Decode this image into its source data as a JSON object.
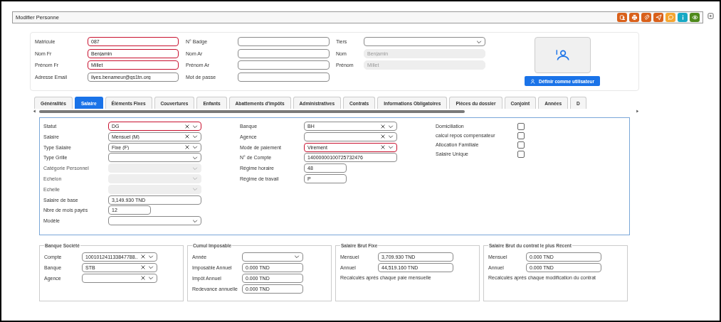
{
  "window": {
    "title": "Modifier Personne"
  },
  "toolbar": [
    {
      "kind": "contacts",
      "color": "#d9601a"
    },
    {
      "kind": "print",
      "color": "#d9601a"
    },
    {
      "kind": "attach",
      "color": "#d9601a"
    },
    {
      "kind": "send",
      "color": "#d9601a"
    },
    {
      "kind": "chat",
      "color": "#f5a530"
    },
    {
      "kind": "info",
      "color": "#17a8c4"
    },
    {
      "kind": "view",
      "color": "#4f8a1c"
    }
  ],
  "identity": {
    "columns": [
      {
        "fields": [
          {
            "label": "Matricule",
            "value": "087",
            "kind": "text",
            "required": true
          },
          {
            "label": "Nom Fr",
            "value": "Benjamin",
            "kind": "text",
            "required": true
          },
          {
            "label": "Prénom Fr",
            "value": "Millet",
            "kind": "text",
            "required": true
          },
          {
            "label": "Adresse Email",
            "value": "ilyes.benameur@gs1tn.org",
            "kind": "text",
            "required": false
          }
        ]
      },
      {
        "fields": [
          {
            "label": "N° Badge",
            "kind": "text",
            "required": false
          },
          {
            "label": "Nom Ar",
            "kind": "text",
            "required": false
          },
          {
            "label": "Prénom Ar",
            "kind": "text",
            "required": false
          },
          {
            "label": "Mot de passe",
            "kind": "text",
            "required": false
          }
        ]
      },
      {
        "fields": [
          {
            "label": "Tiers",
            "kind": "select"
          },
          {
            "label": "Nom",
            "value": "Benjamin",
            "kind": "readonly"
          },
          {
            "label": "Prénom",
            "value": "Millet",
            "kind": "readonly"
          }
        ]
      }
    ],
    "user_button": "Définir comme utilisateur"
  },
  "tabs": [
    {
      "label": "Généralités",
      "selected": false
    },
    {
      "label": "Salaire",
      "selected": true
    },
    {
      "label": "Éléments Fixes",
      "selected": false
    },
    {
      "label": "Couvertures",
      "selected": false
    },
    {
      "label": "Enfants",
      "selected": false
    },
    {
      "label": "Abattements d'impôts",
      "selected": false
    },
    {
      "label": "Administratives",
      "selected": false
    },
    {
      "label": "Contrats",
      "selected": false
    },
    {
      "label": "Informations Obligatoires",
      "selected": false
    },
    {
      "label": "Pièces du dossier",
      "selected": false
    },
    {
      "label": "Conjoint",
      "selected": false
    },
    {
      "label": "Années",
      "selected": false
    },
    {
      "label": "D",
      "selected": false
    }
  ],
  "salary": {
    "left": [
      {
        "label": "Statut",
        "value": "DG",
        "kind": "select",
        "required": true,
        "clearable": true,
        "disabled": false
      },
      {
        "label": "Salaire",
        "value": "Mensuel (M)",
        "kind": "select",
        "required": false,
        "clearable": true,
        "disabled": false
      },
      {
        "label": "Type Salaire",
        "value": "Fixe (F)",
        "kind": "select",
        "required": false,
        "clearable": true,
        "disabled": false
      },
      {
        "label": "Type Grille",
        "kind": "select",
        "required": false,
        "clearable": false,
        "disabled": false
      },
      {
        "label": "Catégorie Personnel",
        "kind": "select",
        "required": false,
        "clearable": false,
        "disabled": true
      },
      {
        "label": "Echelon",
        "kind": "select",
        "required": false,
        "clearable": false,
        "disabled": true
      },
      {
        "label": "Echelle",
        "kind": "select",
        "required": false,
        "clearable": false,
        "disabled": true
      },
      {
        "label": "Salaire de base",
        "value": "3,149.930 TND",
        "kind": "text",
        "required": false,
        "clearable": false,
        "disabled": false
      },
      {
        "label": "Nbre de mois payés",
        "value": "12",
        "kind": "number",
        "required": false,
        "clearable": false,
        "disabled": false
      },
      {
        "label": "Modèle",
        "kind": "select",
        "required": false,
        "clearable": false,
        "disabled": false
      }
    ],
    "middle": [
      {
        "label": "Banque",
        "value": "BH",
        "kind": "select",
        "required": false,
        "clearable": true,
        "disabled": false
      },
      {
        "label": "Agence",
        "kind": "select",
        "required": false,
        "clearable": true,
        "disabled": false
      },
      {
        "label": "Mode de paiement",
        "value": "Virement",
        "kind": "select",
        "required": true,
        "clearable": true,
        "disabled": false
      },
      {
        "label": "N° de Compte",
        "value": "14000000100725732476",
        "kind": "text",
        "required": false,
        "clearable": false,
        "disabled": false
      },
      {
        "label": "Régime horaire",
        "value": "48",
        "kind": "number",
        "required": false,
        "clearable": false,
        "disabled": false
      },
      {
        "label": "Régime de travail",
        "value": "P",
        "kind": "number",
        "required": false,
        "clearable": false,
        "disabled": false
      }
    ],
    "options": [
      {
        "label": "Domiciliation",
        "checked": false
      },
      {
        "label": "calcul repos compensateur",
        "checked": false
      },
      {
        "label": "Allocation Familiale",
        "checked": false
      },
      {
        "label": "Salaire Unique",
        "checked": false
      }
    ]
  },
  "groups": [
    {
      "title": "Banque Société",
      "fields": [
        {
          "label": "Compte",
          "value": "100101241133847788...",
          "kind": "select",
          "clearable": true
        },
        {
          "label": "Banque",
          "value": "STB",
          "kind": "select",
          "clearable": true
        },
        {
          "label": "Agence",
          "kind": "select",
          "clearable": true
        }
      ]
    },
    {
      "title": "Cumul Imposable",
      "fields": [
        {
          "label": "Année",
          "kind": "select",
          "clearable": false
        },
        {
          "label": "Imposable Annuel",
          "value": "0.000 TND",
          "kind": "text",
          "clearable": false
        },
        {
          "label": "Impôt Annuel",
          "value": "0.000 TND",
          "kind": "text",
          "clearable": false
        },
        {
          "label": "Redevance annuelle",
          "value": "0.000 TND",
          "kind": "text",
          "clearable": false
        }
      ]
    },
    {
      "title": "Salaire Brut Fixe",
      "fields": [
        {
          "label": "Mensuel",
          "value": "3,709.930 TND",
          "kind": "text",
          "clearable": false
        },
        {
          "label": "Annuel",
          "value": "44,519.160 TND",
          "kind": "text",
          "clearable": false
        }
      ],
      "note": "Recalculés aprés chaque paie mensuelle"
    },
    {
      "title": "Salaire Brut du contrat le plus Récent",
      "fields": [
        {
          "label": "Mensuel",
          "value": "0.000 TND",
          "kind": "text",
          "clearable": false
        },
        {
          "label": "Annuel",
          "value": "0.000 TND",
          "kind": "text",
          "clearable": false
        }
      ],
      "note": "Recalculés aprés chaque modification du contrat"
    }
  ]
}
